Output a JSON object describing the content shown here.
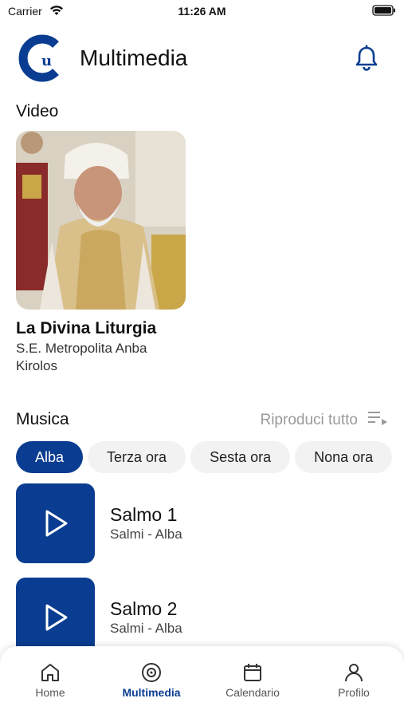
{
  "status": {
    "carrier": "Carrier",
    "time": "11:26 AM"
  },
  "header": {
    "title": "Multimedia",
    "logo_text": "u"
  },
  "video": {
    "section_title": "Video",
    "item": {
      "title": "La Divina Liturgia",
      "author": "S.E. Metropolita Anba Kirolos"
    }
  },
  "music": {
    "section_title": "Musica",
    "play_all_label": "Riproduci tutto",
    "chips": [
      {
        "label": "Alba",
        "active": true
      },
      {
        "label": "Terza ora",
        "active": false
      },
      {
        "label": "Sesta ora",
        "active": false
      },
      {
        "label": "Nona ora",
        "active": false
      }
    ],
    "tracks": [
      {
        "title": "Salmo 1",
        "subtitle": "Salmi - Alba"
      },
      {
        "title": "Salmo 2",
        "subtitle": "Salmi - Alba"
      }
    ]
  },
  "tabs": [
    {
      "label": "Home",
      "icon": "home-icon",
      "active": false
    },
    {
      "label": "Multimedia",
      "icon": "disc-icon",
      "active": true
    },
    {
      "label": "Calendario",
      "icon": "calendar-icon",
      "active": false
    },
    {
      "label": "Profilo",
      "icon": "person-icon",
      "active": false
    }
  ],
  "colors": {
    "accent": "#0a3d91",
    "chip_bg": "#f2f2f2",
    "muted_text": "#9a9a9a"
  }
}
